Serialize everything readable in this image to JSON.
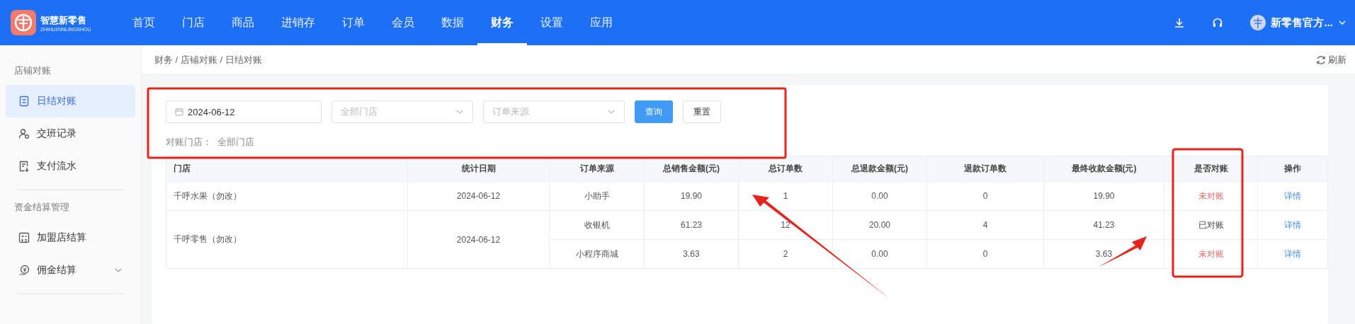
{
  "header": {
    "logo": {
      "name": "智慧新零售",
      "subtitle": "ZHIHUIXINLINGSHOU"
    },
    "nav": [
      {
        "label": "首页",
        "selected": false
      },
      {
        "label": "门店",
        "selected": false
      },
      {
        "label": "商品",
        "selected": false
      },
      {
        "label": "进销存",
        "selected": false
      },
      {
        "label": "订单",
        "selected": false
      },
      {
        "label": "会员",
        "selected": false
      },
      {
        "label": "数据",
        "selected": false
      },
      {
        "label": "财务",
        "selected": true
      },
      {
        "label": "设置",
        "selected": false
      },
      {
        "label": "应用",
        "selected": false
      }
    ],
    "user": "新零售官方..."
  },
  "sidebar": {
    "groups": [
      {
        "title": "店铺对账",
        "items": [
          {
            "label": "日结对账",
            "selected": true
          },
          {
            "label": "交班记录",
            "selected": false
          },
          {
            "label": "支付流水",
            "selected": false
          }
        ]
      },
      {
        "title": "资金结算管理",
        "items": [
          {
            "label": "加盟店结算",
            "selected": false
          },
          {
            "label": "佣金结算",
            "selected": false,
            "expanded": false
          }
        ]
      }
    ]
  },
  "breadcrumb": "财务 / 店铺对账 / 日结对账",
  "refresh": "刷新",
  "filters": {
    "date": "2024-06-12",
    "store": {
      "placeholder": "全部门店"
    },
    "source": {
      "placeholder": "订单来源"
    },
    "buttons": [
      {
        "label": "查询",
        "kind": "primary"
      },
      {
        "label": "重置",
        "kind": "default"
      }
    ],
    "summary_label": "对账门店：",
    "summary_value": "全部门店"
  },
  "table": {
    "columns": [
      "门店",
      "统计日期",
      "订单来源",
      "总销售金额(元)",
      "总订单数",
      "总退款金额(元)",
      "退款订单数",
      "最终收款金额(元)",
      "是否对账",
      "操作"
    ],
    "rows": [
      {
        "store": "千呼水果（勿改）",
        "date": "2024-06-12",
        "entries": [
          {
            "source": "小助手",
            "sales": "19.90",
            "orders": "1",
            "refund": "0.00",
            "refund_orders": "0",
            "final": "19.90",
            "reconciled": false,
            "status": "未对账",
            "action": "详情"
          }
        ]
      },
      {
        "store": "千呼零售（勿改）",
        "date": "2024-06-12",
        "entries": [
          {
            "source": "收银机",
            "sales": "61.23",
            "orders": "12",
            "refund": "20.00",
            "refund_orders": "4",
            "final": "41.23",
            "reconciled": true,
            "status": "已对账",
            "action": "详情"
          },
          {
            "source": "小程序商城",
            "sales": "3.63",
            "orders": "2",
            "refund": "0.00",
            "refund_orders": "0",
            "final": "3.63",
            "reconciled": false,
            "status": "未对账",
            "action": "详情"
          }
        ]
      }
    ]
  }
}
